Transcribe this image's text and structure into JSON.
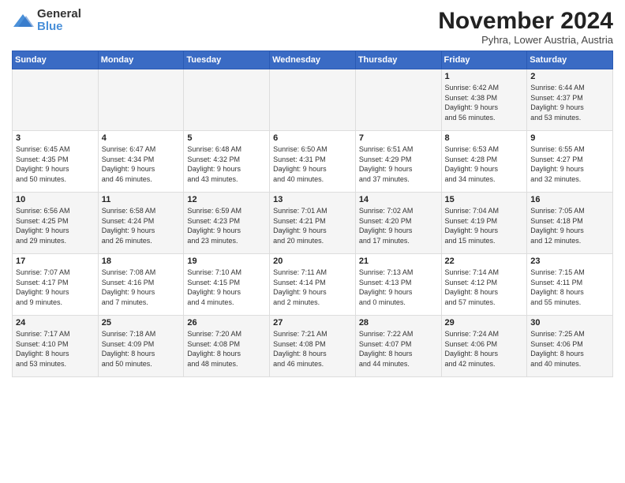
{
  "logo": {
    "general": "General",
    "blue": "Blue"
  },
  "header": {
    "month": "November 2024",
    "location": "Pyhra, Lower Austria, Austria"
  },
  "weekdays": [
    "Sunday",
    "Monday",
    "Tuesday",
    "Wednesday",
    "Thursday",
    "Friday",
    "Saturday"
  ],
  "weeks": [
    [
      {
        "day": "",
        "info": ""
      },
      {
        "day": "",
        "info": ""
      },
      {
        "day": "",
        "info": ""
      },
      {
        "day": "",
        "info": ""
      },
      {
        "day": "",
        "info": ""
      },
      {
        "day": "1",
        "info": "Sunrise: 6:42 AM\nSunset: 4:38 PM\nDaylight: 9 hours\nand 56 minutes."
      },
      {
        "day": "2",
        "info": "Sunrise: 6:44 AM\nSunset: 4:37 PM\nDaylight: 9 hours\nand 53 minutes."
      }
    ],
    [
      {
        "day": "3",
        "info": "Sunrise: 6:45 AM\nSunset: 4:35 PM\nDaylight: 9 hours\nand 50 minutes."
      },
      {
        "day": "4",
        "info": "Sunrise: 6:47 AM\nSunset: 4:34 PM\nDaylight: 9 hours\nand 46 minutes."
      },
      {
        "day": "5",
        "info": "Sunrise: 6:48 AM\nSunset: 4:32 PM\nDaylight: 9 hours\nand 43 minutes."
      },
      {
        "day": "6",
        "info": "Sunrise: 6:50 AM\nSunset: 4:31 PM\nDaylight: 9 hours\nand 40 minutes."
      },
      {
        "day": "7",
        "info": "Sunrise: 6:51 AM\nSunset: 4:29 PM\nDaylight: 9 hours\nand 37 minutes."
      },
      {
        "day": "8",
        "info": "Sunrise: 6:53 AM\nSunset: 4:28 PM\nDaylight: 9 hours\nand 34 minutes."
      },
      {
        "day": "9",
        "info": "Sunrise: 6:55 AM\nSunset: 4:27 PM\nDaylight: 9 hours\nand 32 minutes."
      }
    ],
    [
      {
        "day": "10",
        "info": "Sunrise: 6:56 AM\nSunset: 4:25 PM\nDaylight: 9 hours\nand 29 minutes."
      },
      {
        "day": "11",
        "info": "Sunrise: 6:58 AM\nSunset: 4:24 PM\nDaylight: 9 hours\nand 26 minutes."
      },
      {
        "day": "12",
        "info": "Sunrise: 6:59 AM\nSunset: 4:23 PM\nDaylight: 9 hours\nand 23 minutes."
      },
      {
        "day": "13",
        "info": "Sunrise: 7:01 AM\nSunset: 4:21 PM\nDaylight: 9 hours\nand 20 minutes."
      },
      {
        "day": "14",
        "info": "Sunrise: 7:02 AM\nSunset: 4:20 PM\nDaylight: 9 hours\nand 17 minutes."
      },
      {
        "day": "15",
        "info": "Sunrise: 7:04 AM\nSunset: 4:19 PM\nDaylight: 9 hours\nand 15 minutes."
      },
      {
        "day": "16",
        "info": "Sunrise: 7:05 AM\nSunset: 4:18 PM\nDaylight: 9 hours\nand 12 minutes."
      }
    ],
    [
      {
        "day": "17",
        "info": "Sunrise: 7:07 AM\nSunset: 4:17 PM\nDaylight: 9 hours\nand 9 minutes."
      },
      {
        "day": "18",
        "info": "Sunrise: 7:08 AM\nSunset: 4:16 PM\nDaylight: 9 hours\nand 7 minutes."
      },
      {
        "day": "19",
        "info": "Sunrise: 7:10 AM\nSunset: 4:15 PM\nDaylight: 9 hours\nand 4 minutes."
      },
      {
        "day": "20",
        "info": "Sunrise: 7:11 AM\nSunset: 4:14 PM\nDaylight: 9 hours\nand 2 minutes."
      },
      {
        "day": "21",
        "info": "Sunrise: 7:13 AM\nSunset: 4:13 PM\nDaylight: 9 hours\nand 0 minutes."
      },
      {
        "day": "22",
        "info": "Sunrise: 7:14 AM\nSunset: 4:12 PM\nDaylight: 8 hours\nand 57 minutes."
      },
      {
        "day": "23",
        "info": "Sunrise: 7:15 AM\nSunset: 4:11 PM\nDaylight: 8 hours\nand 55 minutes."
      }
    ],
    [
      {
        "day": "24",
        "info": "Sunrise: 7:17 AM\nSunset: 4:10 PM\nDaylight: 8 hours\nand 53 minutes."
      },
      {
        "day": "25",
        "info": "Sunrise: 7:18 AM\nSunset: 4:09 PM\nDaylight: 8 hours\nand 50 minutes."
      },
      {
        "day": "26",
        "info": "Sunrise: 7:20 AM\nSunset: 4:08 PM\nDaylight: 8 hours\nand 48 minutes."
      },
      {
        "day": "27",
        "info": "Sunrise: 7:21 AM\nSunset: 4:08 PM\nDaylight: 8 hours\nand 46 minutes."
      },
      {
        "day": "28",
        "info": "Sunrise: 7:22 AM\nSunset: 4:07 PM\nDaylight: 8 hours\nand 44 minutes."
      },
      {
        "day": "29",
        "info": "Sunrise: 7:24 AM\nSunset: 4:06 PM\nDaylight: 8 hours\nand 42 minutes."
      },
      {
        "day": "30",
        "info": "Sunrise: 7:25 AM\nSunset: 4:06 PM\nDaylight: 8 hours\nand 40 minutes."
      }
    ]
  ]
}
